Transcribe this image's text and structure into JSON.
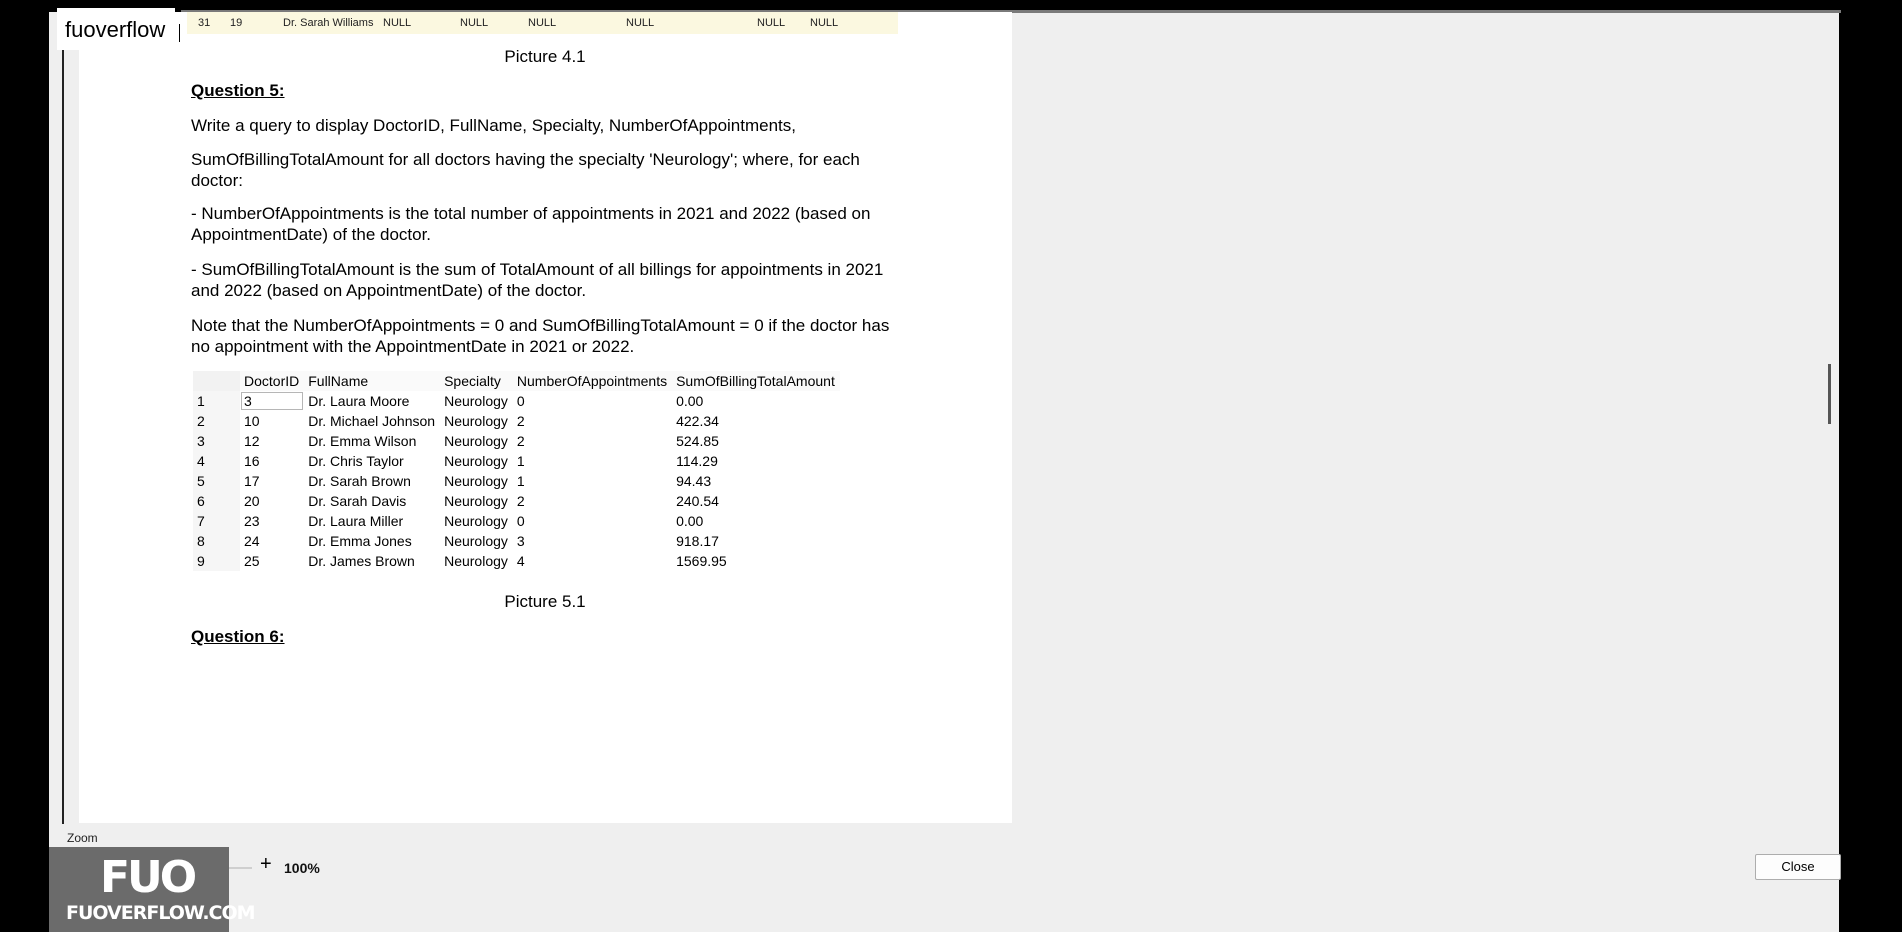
{
  "brand": "fuoverflow",
  "prev_row": [
    "31",
    "19",
    "Dr. Sarah Williams",
    "NULL",
    "NULL",
    "NULL",
    "NULL",
    "NULL",
    "NULL"
  ],
  "picture_41": "Picture 4.1",
  "question5": {
    "title": "Question 5:",
    "p1": "Write a query to display DoctorID, FullName, Specialty, NumberOfAppointments,",
    "p2": "SumOfBillingTotalAmount for all doctors having the specialty 'Neurology'; where, for each doctor:",
    "p3": "- NumberOfAppointments is the total number of appointments in 2021 and 2022 (based on AppointmentDate) of the doctor.",
    "p4": "- SumOfBillingTotalAmount is the sum of TotalAmount of all billings for appointments in 2021 and 2022 (based on AppointmentDate) of the doctor.",
    "p5": "Note that the NumberOfAppointments = 0 and SumOfBillingTotalAmount = 0 if the doctor has no appointment with the AppointmentDate in 2021 or 2022."
  },
  "result_table": {
    "columns": [
      "DoctorID",
      "FullName",
      "Specialty",
      "NumberOfAppointments",
      "SumOfBillingTotalAmount"
    ],
    "rows": [
      [
        "1",
        "3",
        "Dr. Laura Moore",
        "Neurology",
        "0",
        "0.00"
      ],
      [
        "2",
        "10",
        "Dr. Michael Johnson",
        "Neurology",
        "2",
        "422.34"
      ],
      [
        "3",
        "12",
        "Dr. Emma Wilson",
        "Neurology",
        "2",
        "524.85"
      ],
      [
        "4",
        "16",
        "Dr. Chris Taylor",
        "Neurology",
        "1",
        "114.29"
      ],
      [
        "5",
        "17",
        "Dr. Sarah Brown",
        "Neurology",
        "1",
        "94.43"
      ],
      [
        "6",
        "20",
        "Dr. Sarah Davis",
        "Neurology",
        "2",
        "240.54"
      ],
      [
        "7",
        "23",
        "Dr. Laura Miller",
        "Neurology",
        "0",
        "0.00"
      ],
      [
        "8",
        "24",
        "Dr. Emma Jones",
        "Neurology",
        "3",
        "918.17"
      ],
      [
        "9",
        "25",
        "Dr. James Brown",
        "Neurology",
        "4",
        "1569.95"
      ]
    ]
  },
  "picture_51": "Picture 5.1",
  "question6": {
    "title": "Question 6:"
  },
  "zoom": {
    "label": "Zoom",
    "minus": "-",
    "plus": "+",
    "value": "100%"
  },
  "close_label": "Close",
  "logo": {
    "mark": "FUO",
    "text": "FUOVERFLOW.COM"
  }
}
